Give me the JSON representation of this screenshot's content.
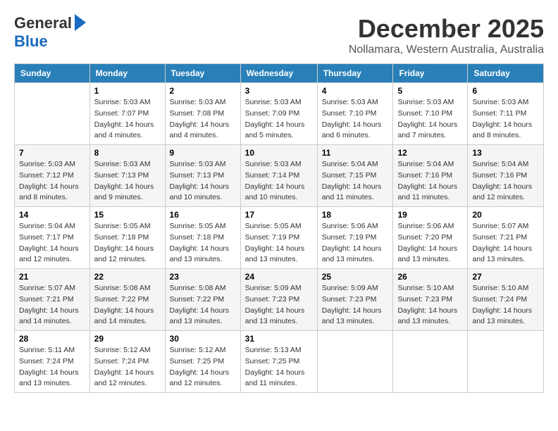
{
  "logo": {
    "general": "General",
    "blue": "Blue"
  },
  "title": "December 2025",
  "location": "Nollamara, Western Australia, Australia",
  "days_of_week": [
    "Sunday",
    "Monday",
    "Tuesday",
    "Wednesday",
    "Thursday",
    "Friday",
    "Saturday"
  ],
  "weeks": [
    [
      {
        "day": "",
        "sunrise": "",
        "sunset": "",
        "daylight": ""
      },
      {
        "day": "1",
        "sunrise": "Sunrise: 5:03 AM",
        "sunset": "Sunset: 7:07 PM",
        "daylight": "Daylight: 14 hours and 4 minutes."
      },
      {
        "day": "2",
        "sunrise": "Sunrise: 5:03 AM",
        "sunset": "Sunset: 7:08 PM",
        "daylight": "Daylight: 14 hours and 4 minutes."
      },
      {
        "day": "3",
        "sunrise": "Sunrise: 5:03 AM",
        "sunset": "Sunset: 7:09 PM",
        "daylight": "Daylight: 14 hours and 5 minutes."
      },
      {
        "day": "4",
        "sunrise": "Sunrise: 5:03 AM",
        "sunset": "Sunset: 7:10 PM",
        "daylight": "Daylight: 14 hours and 6 minutes."
      },
      {
        "day": "5",
        "sunrise": "Sunrise: 5:03 AM",
        "sunset": "Sunset: 7:10 PM",
        "daylight": "Daylight: 14 hours and 7 minutes."
      },
      {
        "day": "6",
        "sunrise": "Sunrise: 5:03 AM",
        "sunset": "Sunset: 7:11 PM",
        "daylight": "Daylight: 14 hours and 8 minutes."
      }
    ],
    [
      {
        "day": "7",
        "sunrise": "Sunrise: 5:03 AM",
        "sunset": "Sunset: 7:12 PM",
        "daylight": "Daylight: 14 hours and 8 minutes."
      },
      {
        "day": "8",
        "sunrise": "Sunrise: 5:03 AM",
        "sunset": "Sunset: 7:13 PM",
        "daylight": "Daylight: 14 hours and 9 minutes."
      },
      {
        "day": "9",
        "sunrise": "Sunrise: 5:03 AM",
        "sunset": "Sunset: 7:13 PM",
        "daylight": "Daylight: 14 hours and 10 minutes."
      },
      {
        "day": "10",
        "sunrise": "Sunrise: 5:03 AM",
        "sunset": "Sunset: 7:14 PM",
        "daylight": "Daylight: 14 hours and 10 minutes."
      },
      {
        "day": "11",
        "sunrise": "Sunrise: 5:04 AM",
        "sunset": "Sunset: 7:15 PM",
        "daylight": "Daylight: 14 hours and 11 minutes."
      },
      {
        "day": "12",
        "sunrise": "Sunrise: 5:04 AM",
        "sunset": "Sunset: 7:16 PM",
        "daylight": "Daylight: 14 hours and 11 minutes."
      },
      {
        "day": "13",
        "sunrise": "Sunrise: 5:04 AM",
        "sunset": "Sunset: 7:16 PM",
        "daylight": "Daylight: 14 hours and 12 minutes."
      }
    ],
    [
      {
        "day": "14",
        "sunrise": "Sunrise: 5:04 AM",
        "sunset": "Sunset: 7:17 PM",
        "daylight": "Daylight: 14 hours and 12 minutes."
      },
      {
        "day": "15",
        "sunrise": "Sunrise: 5:05 AM",
        "sunset": "Sunset: 7:18 PM",
        "daylight": "Daylight: 14 hours and 12 minutes."
      },
      {
        "day": "16",
        "sunrise": "Sunrise: 5:05 AM",
        "sunset": "Sunset: 7:18 PM",
        "daylight": "Daylight: 14 hours and 13 minutes."
      },
      {
        "day": "17",
        "sunrise": "Sunrise: 5:05 AM",
        "sunset": "Sunset: 7:19 PM",
        "daylight": "Daylight: 14 hours and 13 minutes."
      },
      {
        "day": "18",
        "sunrise": "Sunrise: 5:06 AM",
        "sunset": "Sunset: 7:19 PM",
        "daylight": "Daylight: 14 hours and 13 minutes."
      },
      {
        "day": "19",
        "sunrise": "Sunrise: 5:06 AM",
        "sunset": "Sunset: 7:20 PM",
        "daylight": "Daylight: 14 hours and 13 minutes."
      },
      {
        "day": "20",
        "sunrise": "Sunrise: 5:07 AM",
        "sunset": "Sunset: 7:21 PM",
        "daylight": "Daylight: 14 hours and 13 minutes."
      }
    ],
    [
      {
        "day": "21",
        "sunrise": "Sunrise: 5:07 AM",
        "sunset": "Sunset: 7:21 PM",
        "daylight": "Daylight: 14 hours and 14 minutes."
      },
      {
        "day": "22",
        "sunrise": "Sunrise: 5:08 AM",
        "sunset": "Sunset: 7:22 PM",
        "daylight": "Daylight: 14 hours and 14 minutes."
      },
      {
        "day": "23",
        "sunrise": "Sunrise: 5:08 AM",
        "sunset": "Sunset: 7:22 PM",
        "daylight": "Daylight: 14 hours and 13 minutes."
      },
      {
        "day": "24",
        "sunrise": "Sunrise: 5:09 AM",
        "sunset": "Sunset: 7:23 PM",
        "daylight": "Daylight: 14 hours and 13 minutes."
      },
      {
        "day": "25",
        "sunrise": "Sunrise: 5:09 AM",
        "sunset": "Sunset: 7:23 PM",
        "daylight": "Daylight: 14 hours and 13 minutes."
      },
      {
        "day": "26",
        "sunrise": "Sunrise: 5:10 AM",
        "sunset": "Sunset: 7:23 PM",
        "daylight": "Daylight: 14 hours and 13 minutes."
      },
      {
        "day": "27",
        "sunrise": "Sunrise: 5:10 AM",
        "sunset": "Sunset: 7:24 PM",
        "daylight": "Daylight: 14 hours and 13 minutes."
      }
    ],
    [
      {
        "day": "28",
        "sunrise": "Sunrise: 5:11 AM",
        "sunset": "Sunset: 7:24 PM",
        "daylight": "Daylight: 14 hours and 13 minutes."
      },
      {
        "day": "29",
        "sunrise": "Sunrise: 5:12 AM",
        "sunset": "Sunset: 7:24 PM",
        "daylight": "Daylight: 14 hours and 12 minutes."
      },
      {
        "day": "30",
        "sunrise": "Sunrise: 5:12 AM",
        "sunset": "Sunset: 7:25 PM",
        "daylight": "Daylight: 14 hours and 12 minutes."
      },
      {
        "day": "31",
        "sunrise": "Sunrise: 5:13 AM",
        "sunset": "Sunset: 7:25 PM",
        "daylight": "Daylight: 14 hours and 11 minutes."
      },
      {
        "day": "",
        "sunrise": "",
        "sunset": "",
        "daylight": ""
      },
      {
        "day": "",
        "sunrise": "",
        "sunset": "",
        "daylight": ""
      },
      {
        "day": "",
        "sunrise": "",
        "sunset": "",
        "daylight": ""
      }
    ]
  ]
}
